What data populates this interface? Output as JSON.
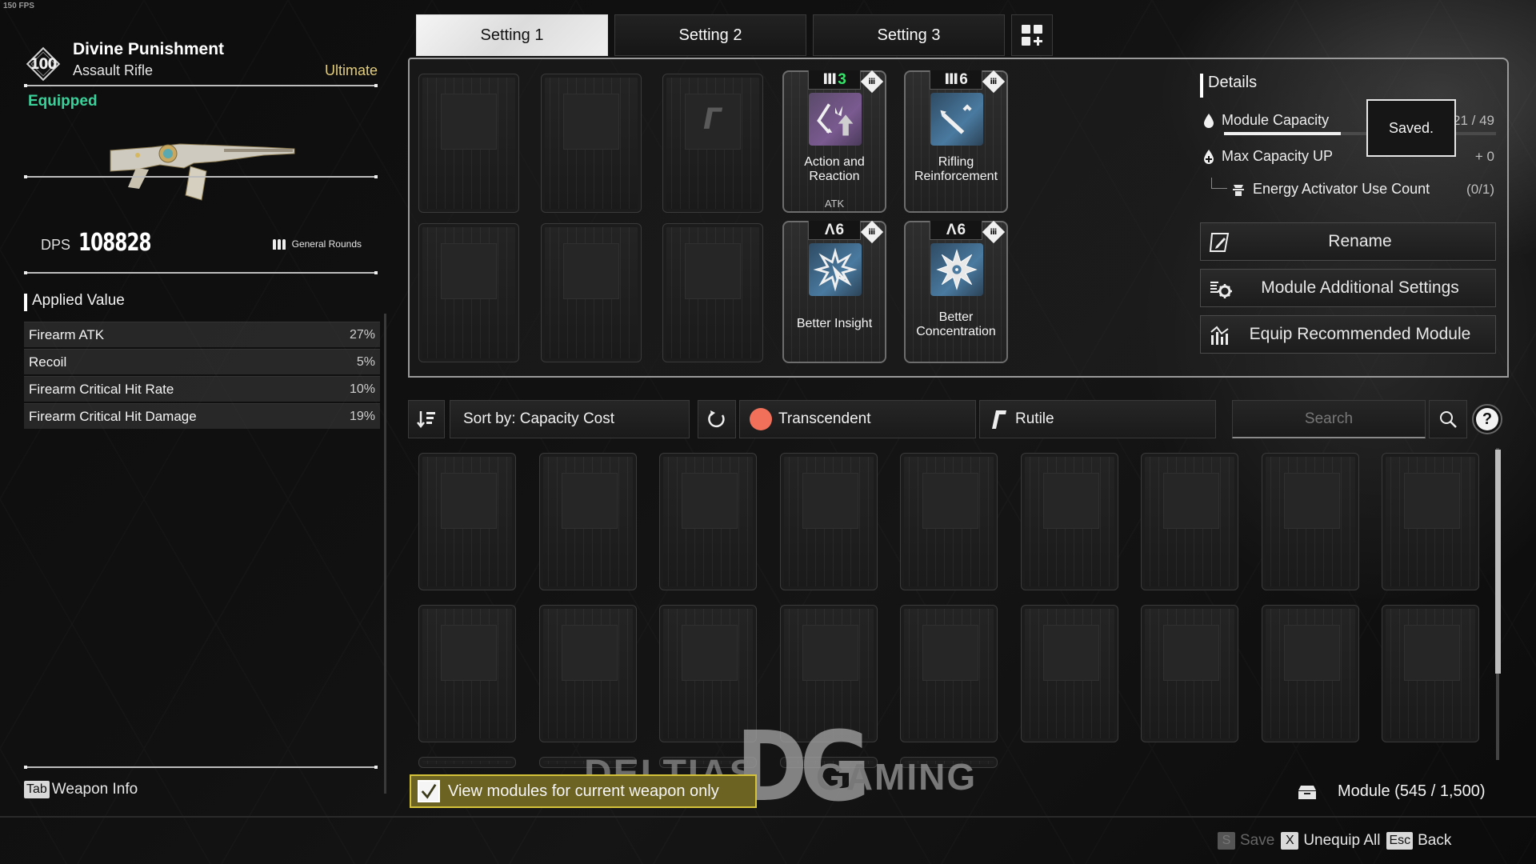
{
  "fps": "150 FPS",
  "weapon": {
    "level": "100",
    "name": "Divine Punishment",
    "type": "Assault Rifle",
    "tier": "Ultimate",
    "status": "Equipped",
    "dps_label": "DPS",
    "dps_value": "108828",
    "ammo_type": "General Rounds"
  },
  "applied_value": {
    "title": "Applied Value",
    "stats": [
      {
        "name": "Firearm ATK",
        "value": "27%"
      },
      {
        "name": "Recoil",
        "value": "5%"
      },
      {
        "name": "Firearm Critical Hit Rate",
        "value": "10%"
      },
      {
        "name": "Firearm Critical Hit Damage",
        "value": "19%"
      }
    ]
  },
  "weapon_info": {
    "key": "Tab",
    "label": "Weapon Info"
  },
  "tabs": [
    {
      "label": "Setting 1",
      "active": true
    },
    {
      "label": "Setting 2",
      "active": false
    },
    {
      "label": "Setting 3",
      "active": false
    }
  ],
  "equipped_modules": [
    {
      "name": "Action and Reaction",
      "cost_symbol": "Ⅲ",
      "cost": "3",
      "tag": "ATK",
      "color": "purple",
      "icon": "action-reaction-icon"
    },
    {
      "name": "Rifling Reinforcement",
      "cost_symbol": "Ⅲ",
      "cost": "6",
      "tag": "",
      "color": "blue",
      "icon": "bullet-upgrade-icon"
    },
    {
      "name": "Better Insight",
      "cost_symbol": "Λ",
      "cost": "6",
      "tag": "",
      "color": "blue",
      "icon": "burst-cursor-icon"
    },
    {
      "name": "Better Concentration",
      "cost_symbol": "Λ",
      "cost": "6",
      "tag": "",
      "color": "blue",
      "icon": "starburst-icon"
    }
  ],
  "details": {
    "title": "Details",
    "module_capacity_label": "Module Capacity",
    "module_capacity_value": "21 / 49",
    "module_capacity_fill": 0.43,
    "max_capacity_label": "Max Capacity UP",
    "max_capacity_value": "+ 0",
    "energy_activator_label": "Energy Activator Use Count",
    "energy_activator_value": "(0/1)",
    "toast": "Saved."
  },
  "actions": {
    "rename": "Rename",
    "additional_settings": "Module Additional Settings",
    "equip_recommended": "Equip Recommended Module"
  },
  "filters": {
    "sort_label": "Sort by: Capacity Cost",
    "rarity": "Transcendent",
    "rarity_color": "#f0705a",
    "socket": "Rutile",
    "search_placeholder": "Search",
    "help": "?"
  },
  "inventory": {
    "view_current_only_label": "View modules for current weapon only",
    "view_current_only_checked": true,
    "count_label": "Module (545 / 1,500)",
    "scroll_position": 0
  },
  "hints": [
    {
      "key": "S",
      "label": "Save",
      "enabled": false
    },
    {
      "key": "X",
      "label": "Unequip All",
      "enabled": true
    },
    {
      "key": "Esc",
      "label": "Back",
      "enabled": true
    }
  ],
  "watermark": {
    "left": "DELTIAS",
    "mark": "DG",
    "right": "GAMING"
  }
}
